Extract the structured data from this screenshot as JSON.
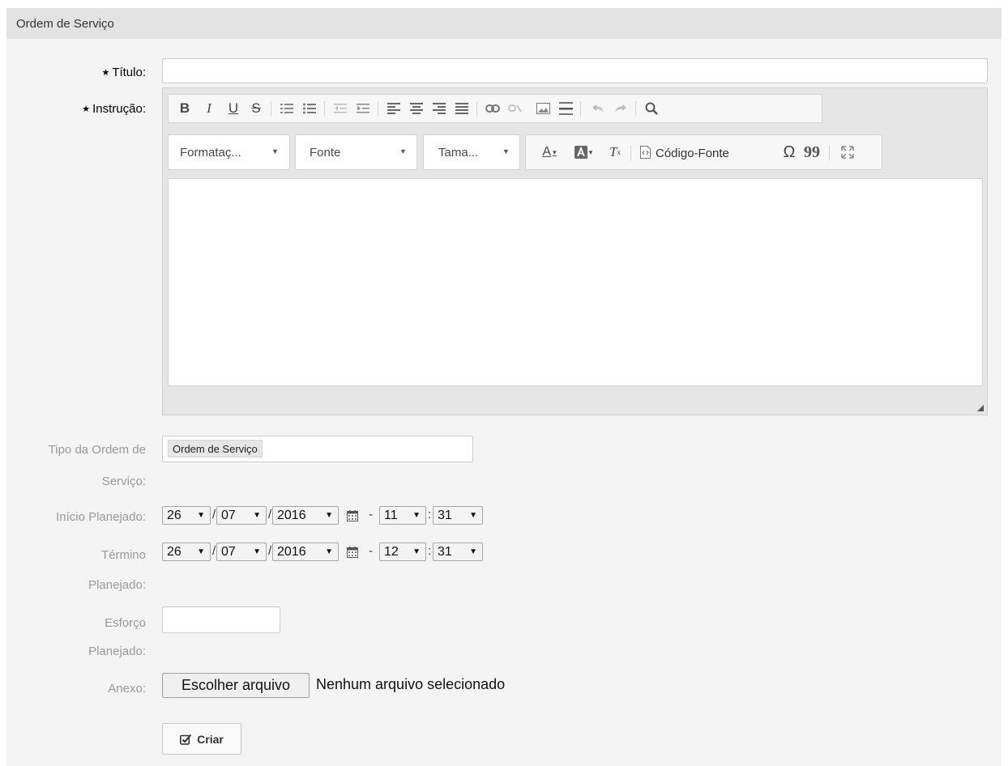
{
  "panel": {
    "title": "Ordem de Serviço"
  },
  "labels": {
    "titulo": "Título:",
    "instrucao": "Instrução:",
    "tipo_line1": "Tipo da Ordem de",
    "tipo_line2": "Serviço:",
    "inicio": "Início Planejado:",
    "termino_line1": "Término",
    "termino_line2": "Planejado:",
    "esforco_line1": "Esforço",
    "esforco_line2": "Planejado:",
    "anexo": "Anexo:"
  },
  "fields": {
    "titulo_value": "",
    "esforco_value": ""
  },
  "editor": {
    "toolbar_row1": [
      "B",
      "I",
      "U",
      "S"
    ],
    "combos": {
      "format": "Formataç...",
      "font": "Fonte",
      "size": "Tama..."
    },
    "source_label": "Código-Fonte",
    "content": ""
  },
  "tipo": {
    "selected": "Ordem de Serviço"
  },
  "inicio": {
    "day": "26",
    "month": "07",
    "year": "2016",
    "hour": "11",
    "minute": "31"
  },
  "termino": {
    "day": "26",
    "month": "07",
    "year": "2016",
    "hour": "12",
    "minute": "31"
  },
  "anexo": {
    "button_label": "Escolher arquivo",
    "status": "Nenhum arquivo selecionado"
  },
  "submit": {
    "label": "Criar"
  },
  "separators": {
    "date": "/",
    "dash": "-",
    "time": ":"
  }
}
